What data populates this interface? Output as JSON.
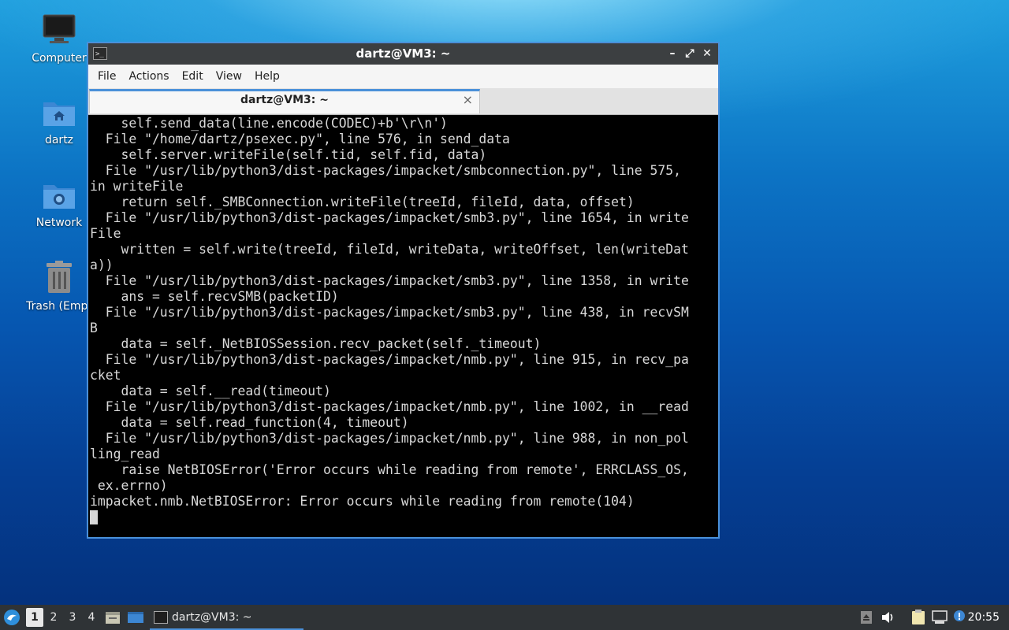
{
  "desktop": {
    "icons": [
      {
        "label": "Computer"
      },
      {
        "label": "dartz"
      },
      {
        "label": "Network"
      },
      {
        "label": "Trash (Empt"
      }
    ]
  },
  "window": {
    "title": "dartz@VM3: ~",
    "menus": [
      "File",
      "Actions",
      "Edit",
      "View",
      "Help"
    ],
    "tab": {
      "label": "dartz@VM3: ~",
      "close": "×"
    },
    "controls": {
      "minimize": "–",
      "maximize": "⤢",
      "close": "✕"
    }
  },
  "terminal": {
    "lines": [
      "    self.send_data(line.encode(CODEC)+b'\\r\\n')",
      "  File \"/home/dartz/psexec.py\", line 576, in send_data",
      "    self.server.writeFile(self.tid, self.fid, data)",
      "  File \"/usr/lib/python3/dist-packages/impacket/smbconnection.py\", line 575,",
      "in writeFile",
      "    return self._SMBConnection.writeFile(treeId, fileId, data, offset)",
      "  File \"/usr/lib/python3/dist-packages/impacket/smb3.py\", line 1654, in write",
      "File",
      "    written = self.write(treeId, fileId, writeData, writeOffset, len(writeDat",
      "a))",
      "  File \"/usr/lib/python3/dist-packages/impacket/smb3.py\", line 1358, in write",
      "    ans = self.recvSMB(packetID)",
      "  File \"/usr/lib/python3/dist-packages/impacket/smb3.py\", line 438, in recvSM",
      "B",
      "    data = self._NetBIOSSession.recv_packet(self._timeout)",
      "  File \"/usr/lib/python3/dist-packages/impacket/nmb.py\", line 915, in recv_pa",
      "cket",
      "    data = self.__read(timeout)",
      "  File \"/usr/lib/python3/dist-packages/impacket/nmb.py\", line 1002, in __read",
      "    data = self.read_function(4, timeout)",
      "  File \"/usr/lib/python3/dist-packages/impacket/nmb.py\", line 988, in non_pol",
      "ling_read",
      "    raise NetBIOSError('Error occurs while reading from remote', ERRCLASS_OS,",
      " ex.errno)",
      "impacket.nmb.NetBIOSError: Error occurs while reading from remote(104)"
    ]
  },
  "taskbar": {
    "workspaces": [
      "1",
      "2",
      "3",
      "4"
    ],
    "task_label": "dartz@VM3: ~",
    "clock": "20:55"
  },
  "colors": {
    "window_border": "#4a90d9",
    "terminal_bg": "#000000",
    "terminal_fg": "#d8d8d8",
    "taskbar_bg": "#2f3336"
  }
}
